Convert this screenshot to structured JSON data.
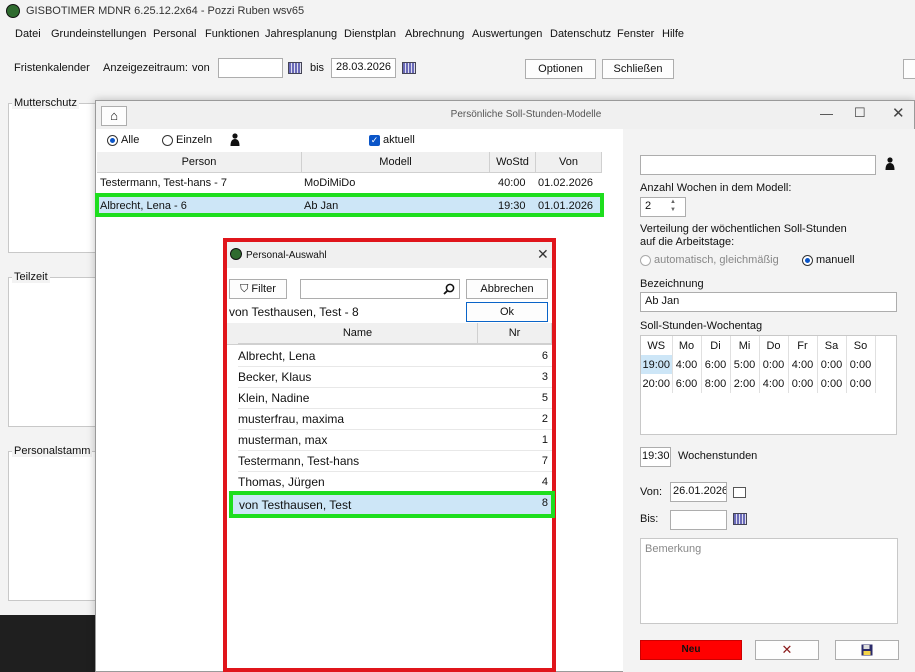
{
  "window": {
    "title": "GISBOTIMER  MDNR 6.25.12.2x64 - Pozzi Ruben wsv65"
  },
  "menu": [
    "Datei",
    "Grundeinstellungen",
    "Personal",
    "Funktionen",
    "Jahresplanung",
    "Dienstplan",
    "Abrechnung",
    "Auswertungen",
    "Datenschutz",
    "Fenster",
    "Hilfe"
  ],
  "toolbar": {
    "fristen_label": "Fristenkalender",
    "anzeige_label": "Anzeigezeitraum:",
    "von_label": "von",
    "von_value": "",
    "bis_label": "bis",
    "bis_value": "28.03.2026",
    "optionen": "Optionen",
    "schliessen": "Schließen"
  },
  "background_panels": {
    "mutterschutz": "Mutterschutz",
    "teilzeit": "Teilzeit",
    "personalstamm": "Personalstamm"
  },
  "dialog": {
    "title": "Persönliche Soll-Stunden-Modelle",
    "filter_alle": "Alle",
    "filter_einzeln": "Einzeln",
    "aktuell_label": "aktuell",
    "columns": [
      "Person",
      "Modell",
      "WoStd",
      "Von"
    ],
    "rows": [
      {
        "person": "Testermann, Test-hans - 7",
        "modell": "MoDiMiDo",
        "wostd": "40:00",
        "von": "01.02.2026"
      },
      {
        "person": "Albrecht, Lena - 6",
        "modell": "Ab Jan",
        "wostd": "19:30",
        "von": "01.01.2026"
      }
    ],
    "right": {
      "person_value": "",
      "anzahl_label": "Anzahl Wochen in dem Modell:",
      "anzahl_value": "2",
      "verteilung_label1": "Verteilung der wöchentlichen Soll-Stunden",
      "verteilung_label2": "auf die Arbeitstage:",
      "option_auto": "automatisch, gleichmäßig",
      "option_manuell": "manuell",
      "bezeichnung_label": "Bezeichnung",
      "bezeichnung_value": "Ab Jan",
      "wochentag_label": "Soll-Stunden-Wochentag",
      "week_headers": [
        "WS",
        "Mo",
        "Di",
        "Mi",
        "Do",
        "Fr",
        "Sa",
        "So"
      ],
      "week_rows": [
        [
          "19:00",
          "4:00",
          "6:00",
          "5:00",
          "0:00",
          "4:00",
          "0:00",
          "0:00"
        ],
        [
          "20:00",
          "6:00",
          "8:00",
          "2:00",
          "4:00",
          "0:00",
          "0:00",
          "0:00"
        ]
      ],
      "wochenstunden_value": "19:30",
      "wochenstunden_label": "Wochenstunden",
      "von_label": "Von:",
      "von_value": "26.01.2026",
      "bis_label": "Bis:",
      "bis_value": "",
      "bemerkung_placeholder": "Bemerkung",
      "neu_button": "Neu"
    }
  },
  "popup": {
    "title": "Personal-Auswahl",
    "filter_button": "Filter",
    "search_value": "",
    "abbrechen": "Abbrechen",
    "selected_text": "von Testhausen, Test - 8",
    "ok": "Ok",
    "columns": [
      "Name",
      "Nr"
    ],
    "rows": [
      {
        "name": "Albrecht, Lena",
        "nr": "6"
      },
      {
        "name": "Becker, Klaus",
        "nr": "3"
      },
      {
        "name": "Klein, Nadine",
        "nr": "5"
      },
      {
        "name": "musterfrau, maxima",
        "nr": "2"
      },
      {
        "name": "musterman, max",
        "nr": "1"
      },
      {
        "name": "Testermann, Test-hans",
        "nr": "7"
      },
      {
        "name": "Thomas, Jürgen",
        "nr": "4"
      },
      {
        "name": "von Testhausen, Test",
        "nr": "8"
      }
    ]
  }
}
